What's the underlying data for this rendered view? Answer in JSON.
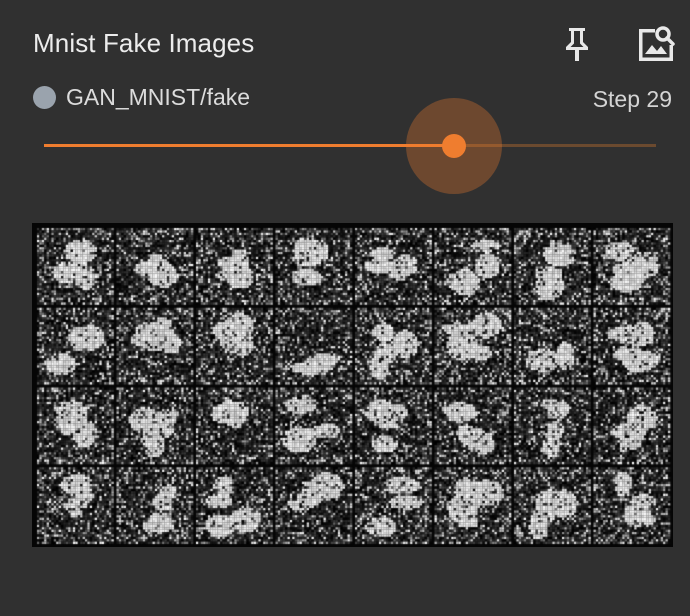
{
  "card": {
    "title": "Mnist Fake Images",
    "pin_icon": "pin-icon",
    "image_settings_icon": "image-search-icon"
  },
  "run": {
    "name": "GAN_MNIST/fake",
    "color": "#9aa3ad"
  },
  "step": {
    "label": "Step 29",
    "value": 29
  },
  "slider": {
    "position_fraction": 0.67,
    "accent_color": "#ef7d2f"
  },
  "image": {
    "description_grid_rows": 4,
    "description_grid_cols": 8
  }
}
